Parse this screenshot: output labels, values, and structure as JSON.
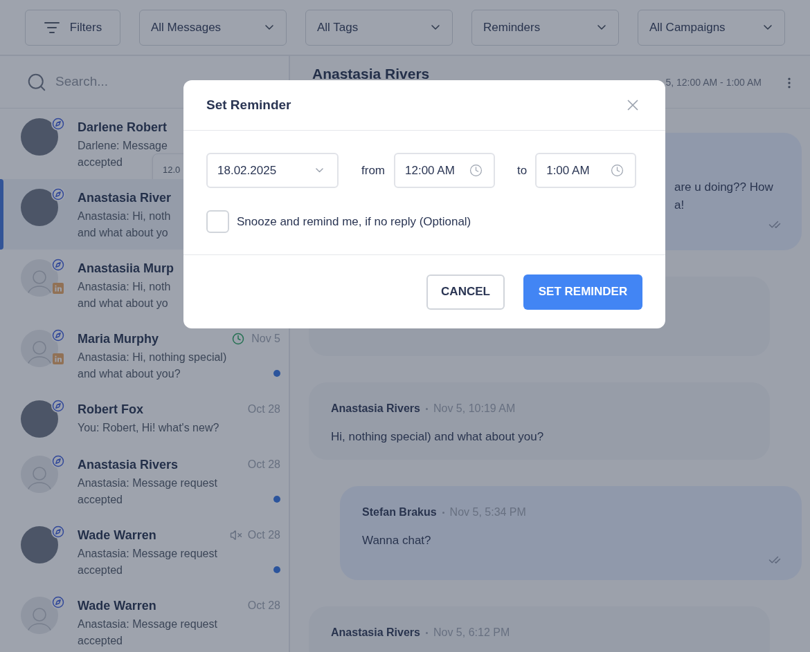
{
  "filters": [
    {
      "kind": "button",
      "label": "Filters"
    },
    {
      "kind": "dropdown",
      "label": "All Messages"
    },
    {
      "kind": "dropdown",
      "label": "All Tags"
    },
    {
      "kind": "dropdown",
      "label": "Reminders"
    },
    {
      "kind": "dropdown",
      "label": "All Campaigns"
    }
  ],
  "search": {
    "placeholder": "Search..."
  },
  "conversations": [
    {
      "name": "Darlene Robert",
      "preview_lines": [
        "Darlene: Message",
        "accepted"
      ],
      "avatar": {
        "kind": "photo"
      },
      "linkedin": false,
      "unread": false,
      "selected": false,
      "tooltip": "12.0"
    },
    {
      "name": "Anastasia River",
      "preview_lines": [
        "Anastasia: Hi, noth",
        "and what about yo"
      ],
      "avatar": {
        "kind": "photo"
      },
      "linkedin": false,
      "unread": false,
      "selected": true
    },
    {
      "name": "Anastasiia Murp",
      "preview_lines": [
        "Anastasia: Hi, noth",
        "and what about yo"
      ],
      "avatar": {
        "kind": "placeholder"
      },
      "linkedin": true,
      "unread": false,
      "selected": false
    },
    {
      "name": "Maria Murphy",
      "preview_lines": [
        "Anastasia: Hi, nothing special)",
        "and what about you?"
      ],
      "date": "Nov 5",
      "avatar": {
        "kind": "placeholder"
      },
      "linkedin": true,
      "status_icon": {
        "kind": "clock"
      },
      "unread": true,
      "selected": false
    },
    {
      "name": "Robert Fox",
      "preview_lines": [
        "You: Robert, Hi! what's new?"
      ],
      "date": "Oct 28",
      "avatar": {
        "kind": "photo"
      },
      "linkedin": false,
      "unread": false,
      "selected": false
    },
    {
      "name": "Anastasia Rivers",
      "preview_lines": [
        "Anastasia: Message request",
        "accepted"
      ],
      "date": "Oct 28",
      "avatar": {
        "kind": "placeholder"
      },
      "linkedin": false,
      "unread": true,
      "selected": false
    },
    {
      "name": "Wade Warren",
      "preview_lines": [
        "Anastasia: Message request",
        "accepted"
      ],
      "date": "Oct 28",
      "avatar": {
        "kind": "photo"
      },
      "linkedin": false,
      "status_icon": {
        "kind": "muted"
      },
      "unread": true,
      "selected": false
    },
    {
      "name": "Wade Warren",
      "preview_lines": [
        "Anastasia: Message request",
        "accepted"
      ],
      "date": "Oct 28",
      "avatar": {
        "kind": "placeholder"
      },
      "linkedin": false,
      "unread": false,
      "selected": false
    }
  ],
  "chat": {
    "title": "Anastasia Rivers",
    "reminder": "5, 12:00 AM - 1:00 AM",
    "messages": [
      {
        "kind": "outgoing",
        "lines": [
          "are u doing?? How",
          "a!"
        ],
        "read": true
      },
      {
        "kind": "incoming",
        "read": false
      },
      {
        "kind": "incoming",
        "sender": "Anastasia Rivers",
        "time": "Nov 5, 10:19 AM",
        "lines": [
          "Hi, nothing special) and what about you?"
        ],
        "read": false
      },
      {
        "kind": "outgoing",
        "sender": "Stefan Brakus",
        "time": "Nov 5, 5:34 PM",
        "lines": [
          "Wanna chat?"
        ],
        "read": true
      },
      {
        "kind": "incoming",
        "sender": "Anastasia Rivers",
        "time": "Nov 5, 6:12 PM",
        "read": false
      }
    ]
  },
  "modal": {
    "title": "Set Reminder",
    "date": "18.02.2025",
    "from_label": "from",
    "from": "12:00 AM",
    "to_label": "to",
    "to": "1:00 AM",
    "snooze": {
      "label": "Snooze and remind me, if no reply (Optional)",
      "checked": false
    },
    "buttons": [
      {
        "kind": "secondary",
        "label": "CANCEL"
      },
      {
        "kind": "primary",
        "label": "SET REMINDER"
      }
    ]
  }
}
